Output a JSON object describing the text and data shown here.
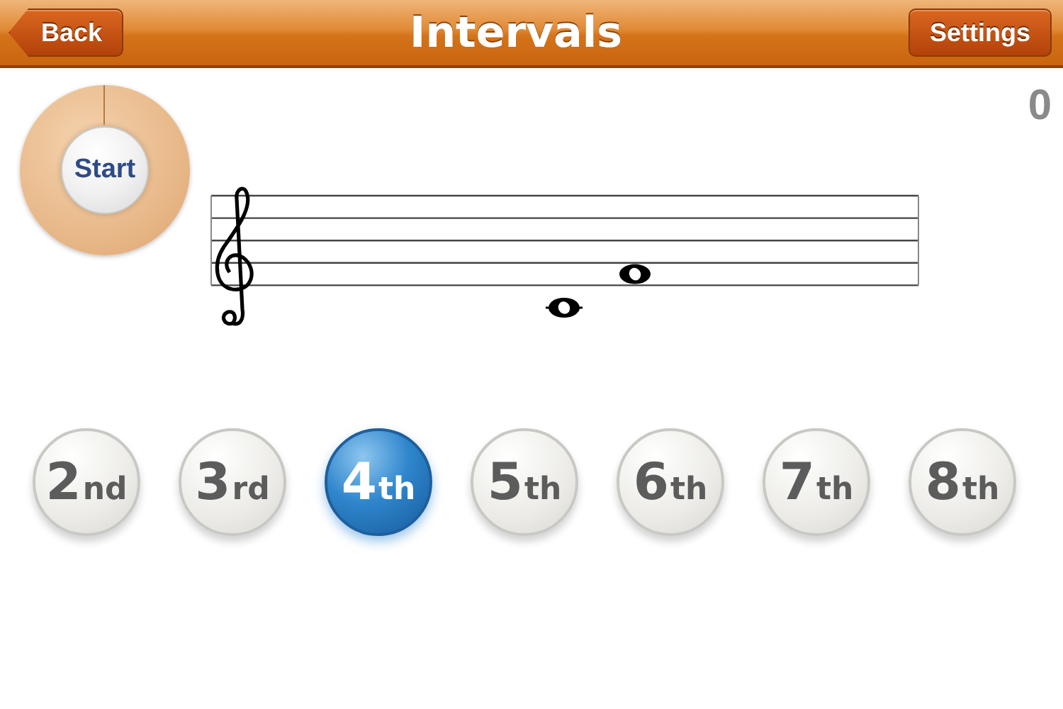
{
  "nav_bar": {
    "back_button": "Back",
    "title": "Intervals",
    "settings_button": "Settings"
  },
  "start_button": "Start",
  "score": "0",
  "staff": {
    "notes": [
      {
        "kind": "ledger"
      },
      {
        "kind": "space"
      }
    ]
  },
  "answers": [
    {
      "number": "2",
      "suffix": "nd",
      "selected": false
    },
    {
      "number": "3",
      "suffix": "rd",
      "selected": false
    },
    {
      "number": "4",
      "suffix": "th",
      "selected": true
    },
    {
      "number": "5",
      "suffix": "th",
      "selected": false
    },
    {
      "number": "6",
      "suffix": "th",
      "selected": false
    },
    {
      "number": "7",
      "suffix": "th",
      "selected": false
    },
    {
      "number": "8",
      "suffix": "th",
      "selected": false
    }
  ]
}
